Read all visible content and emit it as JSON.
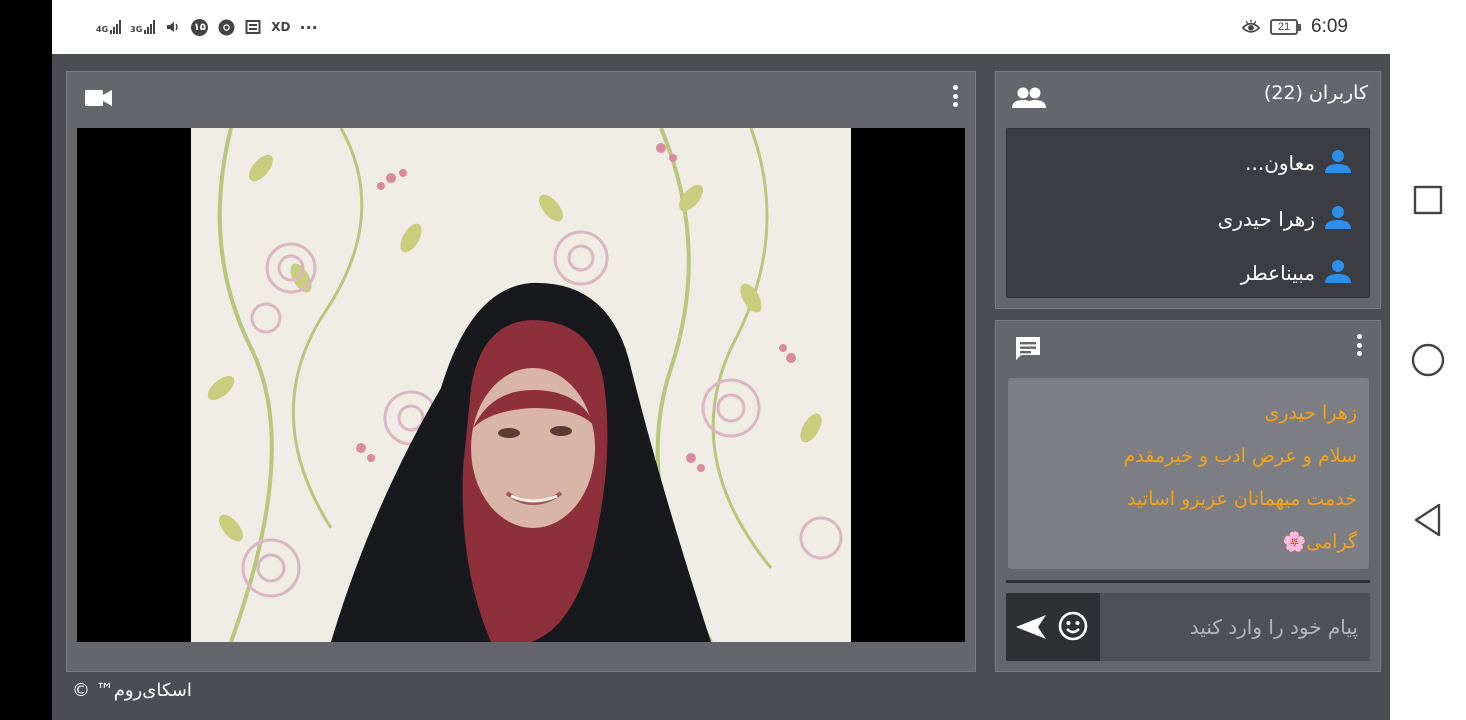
{
  "status_bar": {
    "network_1": "4G",
    "network_2": "3G",
    "badge_number": "۱۵",
    "app_label": "XD",
    "more": "···",
    "battery": "21",
    "time": "6:09"
  },
  "video_panel": {
    "camera_icon": "video-camera-icon",
    "menu_icon": "more-vert-icon"
  },
  "users_panel": {
    "title": "کاربران (22)",
    "icon": "people-icon",
    "users": [
      {
        "name": "معاون..."
      },
      {
        "name": "زهرا حیدری"
      },
      {
        "name": "مبیناعطر"
      }
    ]
  },
  "chat_panel": {
    "icon": "chat-icon",
    "message": {
      "author": "زهرا حیدری",
      "line1": "سلام و عرض ادب و خیرمقدم",
      "line2": "خدمت میهمانان عزیزو اساتید",
      "line3": "گرامی🌸"
    },
    "input_placeholder": "پیام خود را وارد کنید",
    "send_icon": "send-icon",
    "emoji_icon": "emoji-icon"
  },
  "footer": {
    "brand": "اسکای‌روم™ ©"
  },
  "colors": {
    "app_bg": "#4b4d52",
    "panel_bg": "#64666b",
    "message_text": "#f4a41a",
    "user_icon": "#2e8fea"
  }
}
